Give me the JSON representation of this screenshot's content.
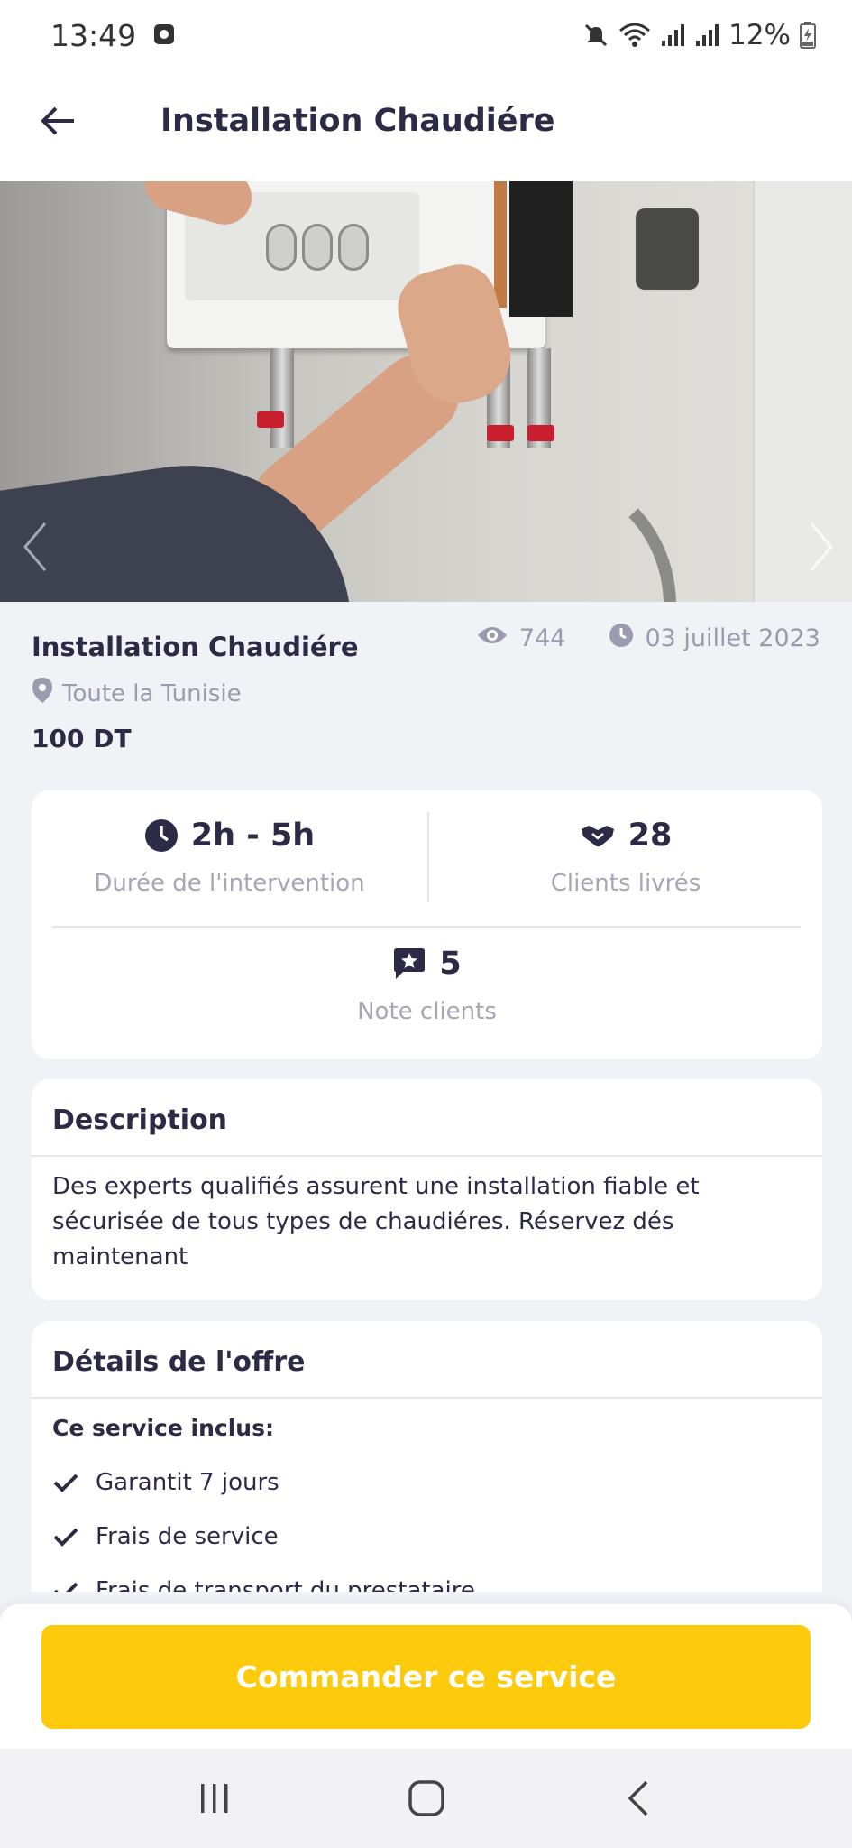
{
  "status_bar": {
    "time": "13:49",
    "battery": "12%",
    "icons": [
      "notification-icon",
      "mute-icon",
      "wifi-icon",
      "signal-icon",
      "signal-icon",
      "battery-charging-icon"
    ]
  },
  "header": {
    "title": "Installation Chaudiére",
    "back_icon": "arrow-left-icon"
  },
  "hero": {
    "image_subject": "boiler-installation-photo",
    "prev_icon": "chevron-left-icon",
    "next_icon": "chevron-right-icon"
  },
  "service": {
    "title": "Installation Chaudiére",
    "views": "744",
    "date": "03 juillet 2023",
    "location": "Toute la Tunisie",
    "price": "100 DT"
  },
  "stats": {
    "duration_value": "2h - 5h",
    "duration_label": "Durée de l'intervention",
    "clients_value": "28",
    "clients_label": "Clients livrés",
    "rating_value": "5",
    "rating_label": "Note clients"
  },
  "description": {
    "heading": "Description",
    "text": "Des experts qualifiés assurent une installation fiable et sécurisée de tous types de chaudiéres. Réservez dés maintenant"
  },
  "offer": {
    "heading": "Détails de l'offre",
    "sub_heading": "Ce service inclus:",
    "items": [
      "Garantit 7 jours",
      "Frais de service",
      "Frais de transport du prestataire"
    ]
  },
  "cta": {
    "label": "Commander ce service"
  },
  "colors": {
    "accent": "#fdcb0b",
    "text_dark": "#2c2a45",
    "text_muted": "#9c9aae",
    "background": "#f0f2f6"
  }
}
